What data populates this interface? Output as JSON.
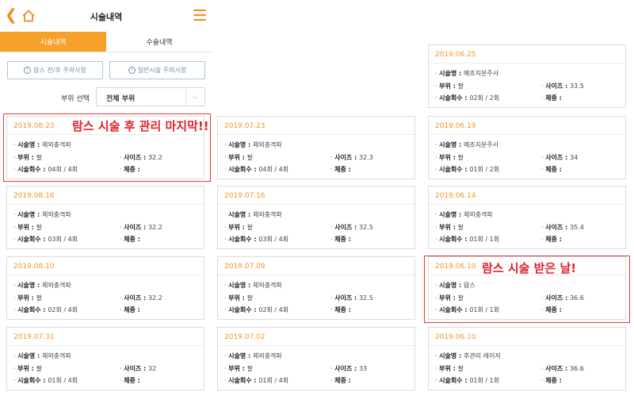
{
  "header": {
    "back_icon": "back-arrow-icon",
    "home_icon": "home-icon",
    "title": "시술내역",
    "menu_icon": "hamburger-menu-icon"
  },
  "tabs": [
    {
      "label": "시술내역",
      "active": true
    },
    {
      "label": "수술내역",
      "active": false
    }
  ],
  "notices": [
    {
      "label": "람스 전/후 주의사항"
    },
    {
      "label": "일반시술 주의사항"
    }
  ],
  "part_filter": {
    "label": "부위 선택",
    "value": "전체 부위"
  },
  "field_labels": {
    "name": "시술명",
    "area": "부위",
    "size": "사이즈",
    "count": "시술회수",
    "weight": "체중"
  },
  "records": [
    {
      "date": "2019.08.23",
      "name": "체외충격파",
      "area": "팔",
      "size": "32.2",
      "count": "04회 / 4회",
      "weight": ""
    },
    {
      "date": "2019.08.16",
      "name": "체외충격파",
      "area": "팔",
      "size": "32.2",
      "count": "03회 / 4회",
      "weight": ""
    },
    {
      "date": "2019.08.10",
      "name": "체외충격파",
      "area": "팔",
      "size": "32.2",
      "count": "02회 / 4회",
      "weight": ""
    },
    {
      "date": "2019.07.31",
      "name": "체외충격파",
      "area": "팔",
      "size": "32",
      "count": "01회 / 4회",
      "weight": ""
    },
    {
      "date": "2019.07.23",
      "name": "체외충격파",
      "area": "팔",
      "size": "32.3",
      "count": "04회 / 4회",
      "weight": ""
    },
    {
      "date": "2019.07.16",
      "name": "체외충격파",
      "area": "팔",
      "size": "32.5",
      "count": "03회 / 4회",
      "weight": ""
    },
    {
      "date": "2019.07.09",
      "name": "체외충격파",
      "area": "팔",
      "size": "32.5",
      "count": "02회 / 4회",
      "weight": ""
    },
    {
      "date": "2019.07.02",
      "name": "체외충격파",
      "area": "팔",
      "size": "33",
      "count": "01회 / 4회",
      "weight": ""
    },
    {
      "date": "2019.06.25",
      "name": "메조지분주사",
      "area": "팔",
      "size": "33.5",
      "count": "02회 / 2회",
      "weight": ""
    },
    {
      "date": "2019.06.19",
      "name": "메조지분주사",
      "area": "팔",
      "size": "34",
      "count": "01회 / 2회",
      "weight": ""
    },
    {
      "date": "2019.06.14",
      "name": "체외충격파",
      "area": "팔",
      "size": "35.4",
      "count": "01회 / 1회",
      "weight": ""
    },
    {
      "date": "2019.06.10",
      "name": "람스",
      "area": "팔",
      "size": "36.6",
      "count": "01회 / 1회",
      "weight": ""
    },
    {
      "date": "2019.06.10",
      "name": "후관리 레이저",
      "area": "팔",
      "size": "36.6",
      "count": "01회 / 1회",
      "weight": ""
    }
  ],
  "annotations": [
    {
      "text": "람스 시술 후 관리 마지막!!",
      "color": "#e0202a"
    },
    {
      "text": "람스 시술 받은 날!",
      "color": "#e0202a"
    }
  ],
  "colors": {
    "accent": "#f7a02b",
    "date": "#f0962a",
    "annotation": "#e0202a",
    "notice_border": "#a9c6e0"
  }
}
